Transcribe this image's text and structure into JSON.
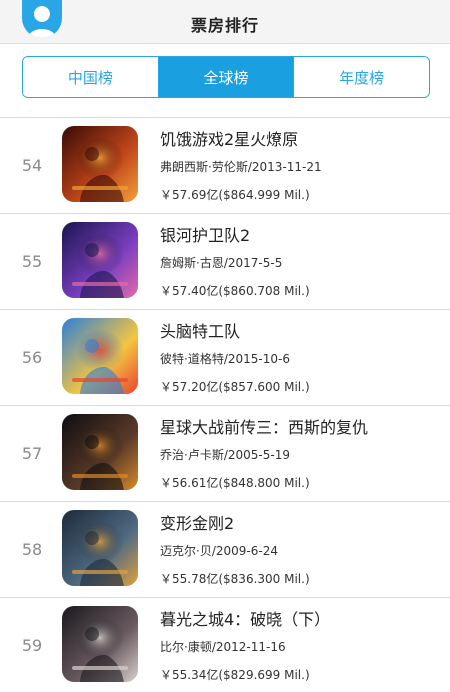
{
  "header": {
    "title": "票房排行",
    "avatar_icon": "user-avatar-icon"
  },
  "tabs": [
    {
      "label": "中国榜",
      "active": false
    },
    {
      "label": "全球榜",
      "active": true
    },
    {
      "label": "年度榜",
      "active": false
    }
  ],
  "colors": {
    "accent": "#1aa0e0",
    "rank_text": "#8a8a8a"
  },
  "movies": [
    {
      "rank": "54",
      "title": "饥饿游戏2星火燎原",
      "meta": "弗朗西斯·劳伦斯/2013-11-21",
      "gross": "￥57.69亿($864.999 Mil.)",
      "poster_colors": [
        "#3a0a06",
        "#c2471a",
        "#f2a13a"
      ]
    },
    {
      "rank": "55",
      "title": "银河护卫队2",
      "meta": "詹姆斯·古恩/2017-5-5",
      "gross": "￥57.40亿($860.708 Mil.)",
      "poster_colors": [
        "#1a1550",
        "#7a3fc0",
        "#e46aa8"
      ]
    },
    {
      "rank": "56",
      "title": "头脑特工队",
      "meta": "彼特·道格特/2015-10-6",
      "gross": "￥57.20亿($857.600 Mil.)",
      "poster_colors": [
        "#2a7fd8",
        "#f4c542",
        "#e8442e"
      ]
    },
    {
      "rank": "57",
      "title": "星球大战前传三：西斯的复仇",
      "meta": "乔治·卢卡斯/2005-5-19",
      "gross": "￥56.61亿($848.800 Mil.)",
      "poster_colors": [
        "#0d0d10",
        "#5a3a28",
        "#d9892a"
      ]
    },
    {
      "rank": "58",
      "title": "变形金刚2",
      "meta": "迈克尔·贝/2009-6-24",
      "gross": "￥55.78亿($836.300 Mil.)",
      "poster_colors": [
        "#1d2a3a",
        "#4f6a82",
        "#e0a040"
      ]
    },
    {
      "rank": "59",
      "title": "暮光之城4：破晓（下）",
      "meta": "比尔·康顿/2012-11-16",
      "gross": "￥55.34亿($829.699 Mil.)",
      "poster_colors": [
        "#1a1a1e",
        "#6a5a60",
        "#d8d0cc"
      ]
    }
  ]
}
